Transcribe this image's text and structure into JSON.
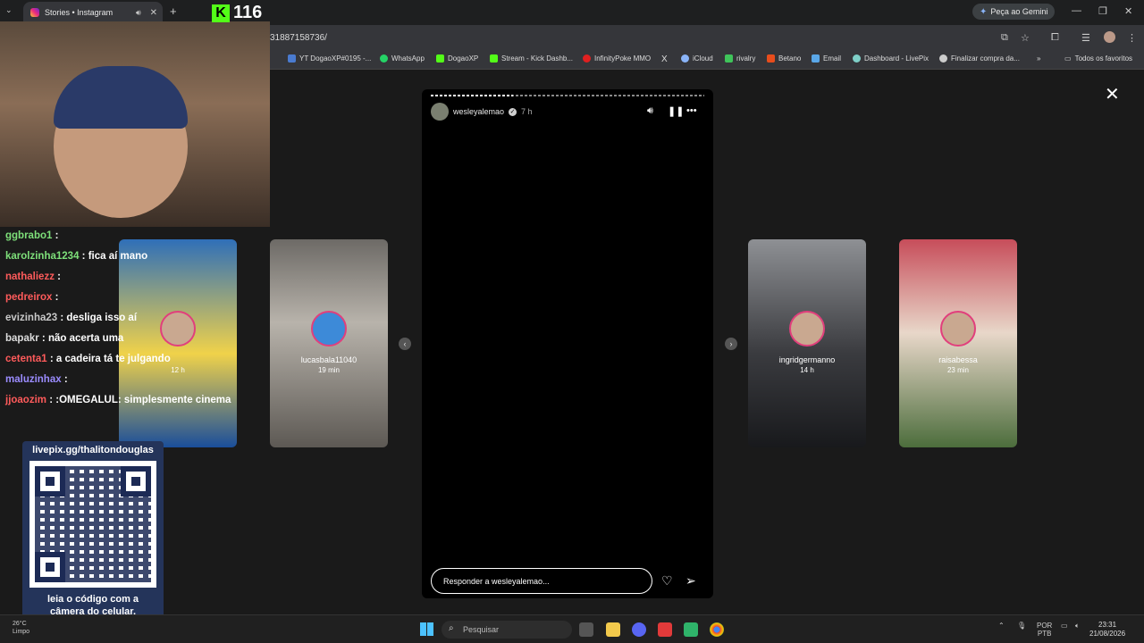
{
  "browser": {
    "tab_title": "Stories • Instagram",
    "new_tab": "+",
    "gemini_label": "Peça ao Gemini",
    "url": "31887158736/",
    "bookmarks": [
      "YT DogaoXP#0195 -...",
      "WhatsApp",
      "DogaoXP",
      "Stream - Kick Dashb...",
      "InfinityPoke MMO",
      "X",
      "iCloud",
      "rivalry",
      "Betano",
      "Email",
      "Dashboard - LivePix",
      "Finalizar compra da..."
    ],
    "more_bookmarks": "»",
    "all_bookmarks": "Todos os favoritos"
  },
  "stream": {
    "kick_count": "116",
    "chat": [
      {
        "user": "ggbrabo1",
        "msg": "",
        "color": "#7ee07a"
      },
      {
        "user": "karolzinha1234",
        "msg": "fica aí mano",
        "color": "#7ee07a"
      },
      {
        "user": "nathaliezz",
        "msg": "",
        "color": "#ff5b5b"
      },
      {
        "user": "pedreirox",
        "msg": "",
        "color": "#ff5b5b"
      },
      {
        "user": "evizinha23",
        "msg": "desliga isso aí",
        "color": "#c9c9c9"
      },
      {
        "user": "bapakr",
        "msg": "não acerta uma",
        "color": "#dddddd"
      },
      {
        "user": "cetenta1",
        "msg": "a cadeira tá te julgando",
        "color": "#ff5b5b"
      },
      {
        "user": "maluzinhax",
        "msg": "",
        "color": "#9b8cff"
      },
      {
        "user": "jjoaozim",
        "msg": ":OMEGALUL: simplesmente cinema",
        "color": "#ff5b5b"
      }
    ],
    "qr_url": "livepix.gg/thalitondouglas",
    "qr_caption_1": "leia o código com a",
    "qr_caption_2": "câmera do celular."
  },
  "story": {
    "username": "wesleyalemao",
    "time": "7 h",
    "reply_placeholder": "Responder a wesleyalemao...",
    "progress": 0.3
  },
  "side_stories": [
    {
      "name": "",
      "time": "12 h"
    },
    {
      "name": "lucasbala11040",
      "time": "19 min"
    },
    {
      "name": "ingridgermanno",
      "time": "14 h"
    },
    {
      "name": "raisabessa",
      "time": "23 min"
    }
  ],
  "taskbar": {
    "weather_temp": "26°C",
    "weather_desc": "Limpo",
    "search_placeholder": "Pesquisar",
    "lang": "POR",
    "layout": "PTB",
    "time": "23:31",
    "date": "21/08/2026"
  }
}
